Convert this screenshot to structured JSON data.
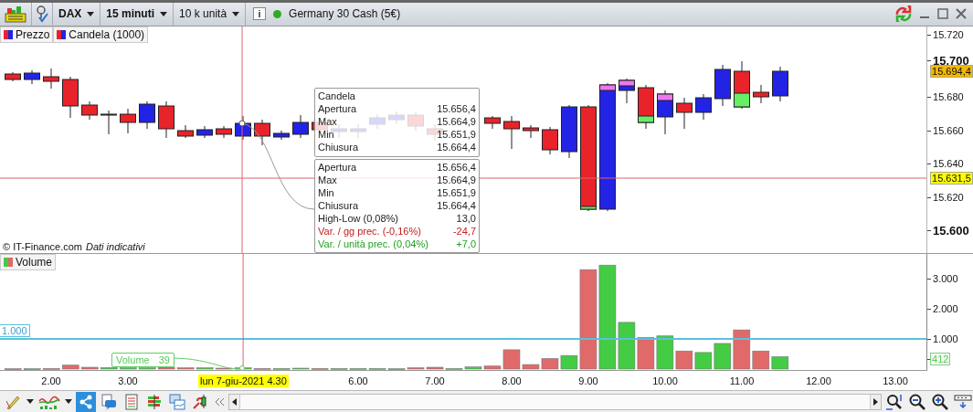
{
  "toolbar": {
    "instrument": "DAX",
    "timeframe": "15 minuti",
    "units": "10 k unità",
    "market": {
      "name": "Germany 30 Cash (5€)",
      "open": true
    }
  },
  "legend": [
    "Prezzo",
    "Candela (1000)"
  ],
  "price_axis": [
    {
      "label": "15.720",
      "kind": "minor"
    },
    {
      "label": "15.700",
      "kind": "major"
    },
    {
      "label": "15.680",
      "kind": "minor"
    },
    {
      "label": "15.660",
      "kind": "minor"
    },
    {
      "label": "15.640",
      "kind": "minor"
    },
    {
      "label": "15.620",
      "kind": "minor"
    },
    {
      "label": "15.600",
      "kind": "major"
    }
  ],
  "price_markers": [
    {
      "label": "15.694,4",
      "kind": "last"
    },
    {
      "label": "15.631,5",
      "kind": "cursor"
    }
  ],
  "candle_tooltip": {
    "title": "Candela",
    "rows": [
      {
        "label": "Apertura",
        "value": "15.656,4"
      },
      {
        "label": "Max",
        "value": "15.664,9"
      },
      {
        "label": "Min",
        "value": "15.651,9"
      },
      {
        "label": "Chiusura",
        "value": "15.664,4"
      }
    ]
  },
  "detail_tooltip": {
    "rows": [
      {
        "label": "Apertura",
        "value": "15.656,4",
        "kind": "neutral"
      },
      {
        "label": "Max",
        "value": "15.664,9",
        "kind": "neutral"
      },
      {
        "label": "Min",
        "value": "15.651,9",
        "kind": "neutral"
      },
      {
        "label": "Chiusura",
        "value": "15.664,4",
        "kind": "neutral"
      },
      {
        "label": "High-Low (0,08%)",
        "value": "13,0",
        "kind": "neutral"
      },
      {
        "label": "Var. / gg prec. (-0,16%)",
        "value": "-24,7",
        "kind": "negative"
      },
      {
        "label": "Var. / unità prec. (0,04%)",
        "value": "+7,0",
        "kind": "positive"
      }
    ]
  },
  "copyright": "© IT-Finance.com",
  "disclaimer": "Dati indicativi",
  "volume": {
    "legend": "Volume",
    "last_marker": "412",
    "cursor_tooltip": {
      "label": "Volume",
      "value": "39"
    },
    "chart_data": {
      "type": "bar",
      "xlim": [
        1.33,
        13.42
      ],
      "ylim": [
        0,
        3820
      ],
      "ref_lines": [
        {
          "axis": "y",
          "value": 1000,
          "label": "1.000",
          "color": "#5bc0de"
        },
        {
          "axis": "x",
          "value": 4.5,
          "color": "#e06070"
        }
      ],
      "x": [
        1.5,
        1.75,
        2,
        2.25,
        2.5,
        2.75,
        3,
        3.25,
        3.5,
        3.75,
        4,
        4.25,
        4.5,
        4.75,
        5,
        5.25,
        5.5,
        5.75,
        6,
        6.25,
        6.5,
        6.75,
        7,
        7.25,
        7.5,
        7.75,
        8,
        8.25,
        8.5,
        8.75,
        9,
        9.25,
        9.5,
        9.75,
        10,
        10.25,
        10.5,
        10.75,
        11,
        11.25,
        11.5
      ],
      "series": [
        {
          "color": "#e06a6a",
          "values": [
            10,
            null,
            20,
            130,
            60,
            null,
            null,
            null,
            60,
            40,
            null,
            30,
            null,
            20,
            null,
            null,
            20,
            null,
            null,
            null,
            null,
            40,
            60,
            null,
            null,
            100,
            640,
            150,
            350,
            null,
            3300,
            null,
            null,
            1050,
            null,
            600,
            null,
            null,
            1300,
            600,
            null
          ]
        },
        {
          "color": "#44cc44",
          "values": [
            null,
            10,
            null,
            null,
            null,
            50,
            40,
            40,
            null,
            null,
            40,
            null,
            40,
            null,
            20,
            30,
            null,
            20,
            20,
            20,
            10,
            null,
            null,
            20,
            70,
            null,
            null,
            null,
            null,
            450,
            null,
            3450,
            1550,
            null,
            1100,
            null,
            550,
            850,
            null,
            null,
            410
          ]
        }
      ],
      "xticks": [
        {
          "value": 2,
          "label": "2.00"
        },
        {
          "value": 3,
          "label": "3.00"
        },
        {
          "value": 6,
          "label": "6.00"
        },
        {
          "value": 7,
          "label": "7.00"
        },
        {
          "value": 8,
          "label": "8.00"
        },
        {
          "value": 9,
          "label": "9.00"
        },
        {
          "value": 10,
          "label": "10.00"
        },
        {
          "value": 11,
          "label": "11.00"
        },
        {
          "value": 12,
          "label": "12.00"
        },
        {
          "value": 13,
          "label": "13.00"
        }
      ],
      "yticks": [
        {
          "value": 1000,
          "label": "1.000"
        },
        {
          "value": 2000,
          "label": "2.000"
        },
        {
          "value": 3000,
          "label": "3.000"
        }
      ]
    }
  },
  "time_axis": {
    "cursor_label": "lun 7-giu-2021 4.30"
  },
  "bottom_toolbar": {
    "share": {
      "selected": true
    }
  }
}
